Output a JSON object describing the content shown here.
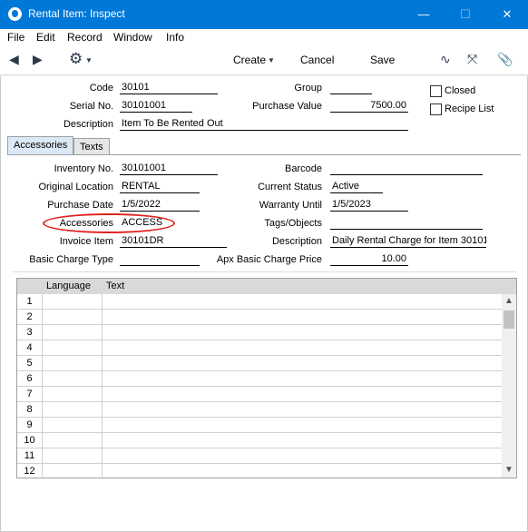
{
  "window": {
    "title": "Rental Item: Inspect",
    "minimize": "—",
    "maximize": "☐",
    "close": "✕"
  },
  "menu": [
    "File",
    "Edit",
    "Record",
    "Window",
    "Info"
  ],
  "toolbar": {
    "create": "Create",
    "cancel": "Cancel",
    "save": "Save"
  },
  "header": {
    "code_label": "Code",
    "code": "30101",
    "serial_label": "Serial No.",
    "serial": "30101001",
    "description_label": "Description",
    "description": "Item To Be Rented Out",
    "group_label": "Group",
    "group": "",
    "purchase_value_label": "Purchase Value",
    "purchase_value": "7500.00",
    "closed_label": "Closed",
    "closed": false,
    "recipe_list_label": "Recipe List",
    "recipe_list": false
  },
  "tabs": [
    {
      "label": "Accessories",
      "active": true
    },
    {
      "label": "Texts",
      "active": false
    }
  ],
  "accessories": {
    "inventory_no_label": "Inventory No.",
    "inventory_no": "30101001",
    "original_location_label": "Original Location",
    "original_location": "RENTAL",
    "purchase_date_label": "Purchase Date",
    "purchase_date": "1/5/2022",
    "accessories_label": "Accessories",
    "accessories": "ACCESS",
    "invoice_item_label": "Invoice Item",
    "invoice_item": "30101DR",
    "basic_charge_type_label": "Basic Charge Type",
    "basic_charge_type": "",
    "barcode_label": "Barcode",
    "barcode": "",
    "current_status_label": "Current Status",
    "current_status": "Active",
    "warranty_until_label": "Warranty Until",
    "warranty_until": "1/5/2023",
    "tags_label": "Tags/Objects",
    "tags": "",
    "inv_description_label": "Description",
    "inv_description": "Daily Rental Charge for Item 30101",
    "apx_price_label": "Apx Basic Charge Price",
    "apx_price": "10.00"
  },
  "grid": {
    "columns": [
      "Language",
      "Text"
    ],
    "rows": [
      "1",
      "2",
      "3",
      "4",
      "5",
      "6",
      "7",
      "8",
      "9",
      "10",
      "11",
      "12"
    ]
  },
  "colors": {
    "titlebar": "#0078d7",
    "active_tab": "#dbe9f7",
    "highlight_oval": "#e0201e"
  }
}
